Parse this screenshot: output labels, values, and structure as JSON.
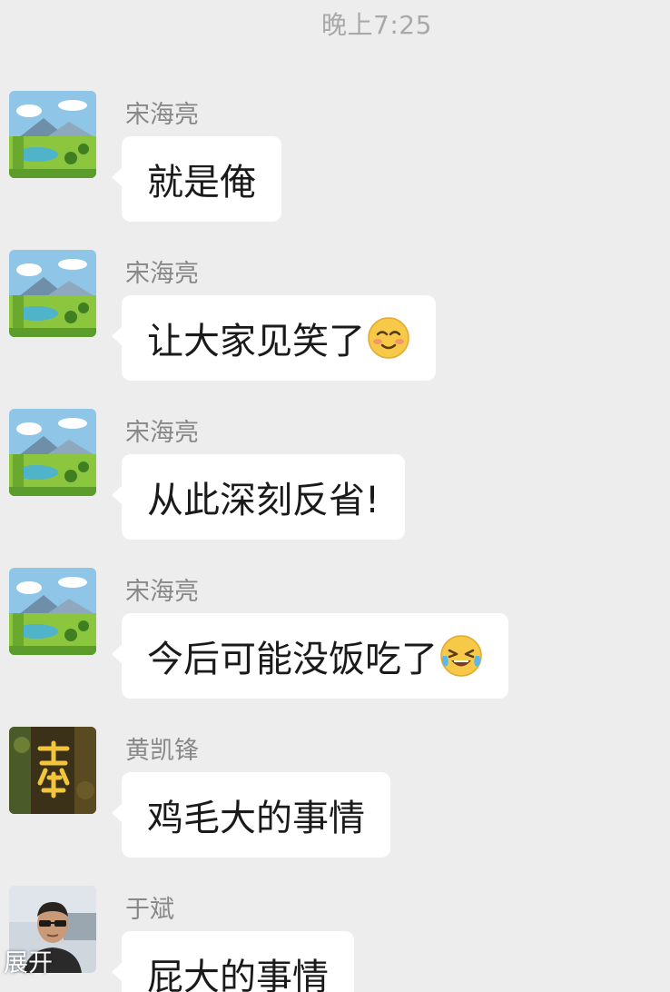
{
  "timestamp": "晚上7:25",
  "messages": [
    {
      "sender": "宋海亮",
      "text": "就是俺",
      "avatar": "landscape-avatar-icon",
      "emoji": null
    },
    {
      "sender": "宋海亮",
      "text": "让大家见笑了",
      "avatar": "landscape-avatar-icon",
      "emoji": "blushing-smile-emoji"
    },
    {
      "sender": "宋海亮",
      "text": "从此深刻反省!",
      "avatar": "landscape-avatar-icon",
      "emoji": null
    },
    {
      "sender": "宋海亮",
      "text": "今后可能没饭吃了",
      "avatar": "landscape-avatar-icon",
      "emoji": "crying-laughing-emoji"
    },
    {
      "sender": "黄凯锋",
      "text": "鸡毛大的事情",
      "avatar": "calligraphy-avatar-icon",
      "emoji": null
    },
    {
      "sender": "于斌",
      "text": "屁大的事情",
      "avatar": "man-portrait-avatar-icon",
      "emoji": null
    }
  ],
  "expand_label": "展开",
  "colors": {
    "background": "#ededed",
    "bubble": "#ffffff",
    "sender_name": "#888888",
    "timestamp": "#a8a8a8"
  }
}
